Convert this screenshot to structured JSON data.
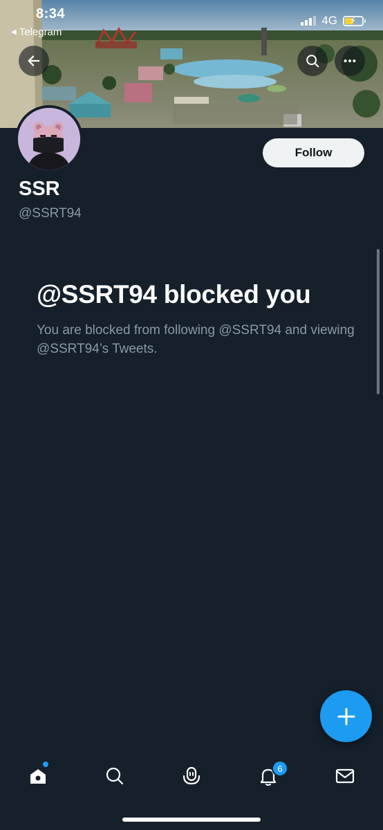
{
  "status_bar": {
    "time": "8:34",
    "back_app": "Telegram",
    "network": "4G"
  },
  "header": {
    "back_icon": "arrow-left-icon",
    "search_icon": "search-icon",
    "more_icon": "more-horizontal-icon"
  },
  "profile": {
    "display_name": "SSR",
    "handle": "@SSRT94",
    "follow_label": "Follow"
  },
  "blocked": {
    "title": "@SSRT94 blocked you",
    "description": "You are blocked from following @SSRT94 and viewing @SSRT94’s Tweets."
  },
  "fab": {
    "icon": "plus-icon"
  },
  "bottom_nav": {
    "items": [
      {
        "name": "home",
        "icon": "home-icon",
        "has_dot": true
      },
      {
        "name": "search",
        "icon": "search-icon"
      },
      {
        "name": "spaces",
        "icon": "spaces-icon"
      },
      {
        "name": "notifications",
        "icon": "bell-icon",
        "badge": "6"
      },
      {
        "name": "messages",
        "icon": "mail-icon"
      }
    ]
  },
  "colors": {
    "background": "#15202b",
    "accent": "#1d9bf0",
    "secondary_text": "#8b98a5",
    "follow_button_bg": "#eff3f4"
  }
}
